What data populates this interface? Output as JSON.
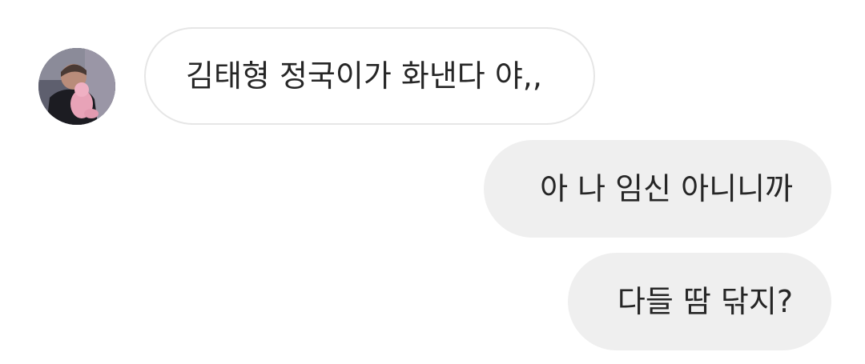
{
  "conversation": {
    "received": [
      {
        "text": "김태형 정국이가 화낸다 야,,",
        "avatar": "profile-photo"
      }
    ],
    "sent": [
      {
        "text": "아 나 임신 아니니까"
      },
      {
        "text": "다들 땀 닦지?"
      }
    ]
  },
  "colors": {
    "received_bubble_bg": "#ffffff",
    "received_bubble_border": "#e6e6e6",
    "sent_bubble_bg": "#efefef",
    "text": "#262626"
  }
}
